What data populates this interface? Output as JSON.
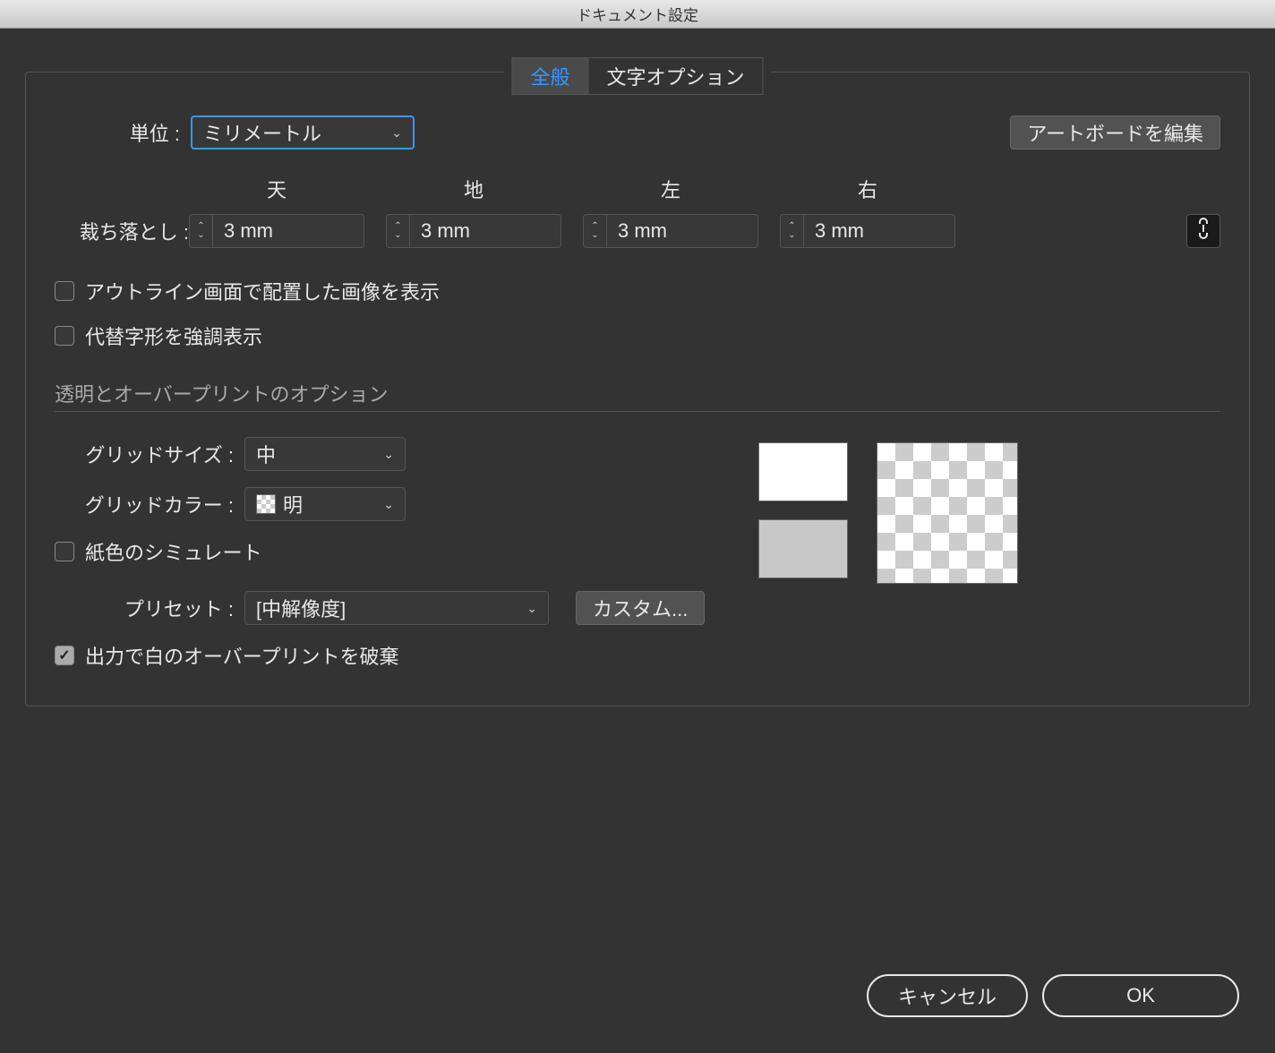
{
  "title": "ドキュメント設定",
  "tabs": {
    "general": "全般",
    "typeOptions": "文字オプション"
  },
  "units": {
    "label": "単位 :",
    "value": "ミリメートル"
  },
  "editArtboards": "アートボードを編集",
  "bleed": {
    "label": "裁ち落とし :",
    "top": {
      "label": "天",
      "value": "3 mm"
    },
    "bottom": {
      "label": "地",
      "value": "3 mm"
    },
    "left": {
      "label": "左",
      "value": "3 mm"
    },
    "right": {
      "label": "右",
      "value": "3 mm"
    }
  },
  "checkboxes": {
    "showOutline": "アウトライン画面で配置した画像を表示",
    "highlightGlyphs": "代替字形を強調表示",
    "simulatePaper": "紙色のシミュレート",
    "discardOverprint": "出力で白のオーバープリントを破棄"
  },
  "section": "透明とオーバープリントのオプション",
  "gridSize": {
    "label": "グリッドサイズ :",
    "value": "中"
  },
  "gridColor": {
    "label": "グリッドカラー :",
    "value": "明"
  },
  "preset": {
    "label": "プリセット :",
    "value": "[中解像度]"
  },
  "custom": "カスタム...",
  "buttons": {
    "cancel": "キャンセル",
    "ok": "OK"
  }
}
